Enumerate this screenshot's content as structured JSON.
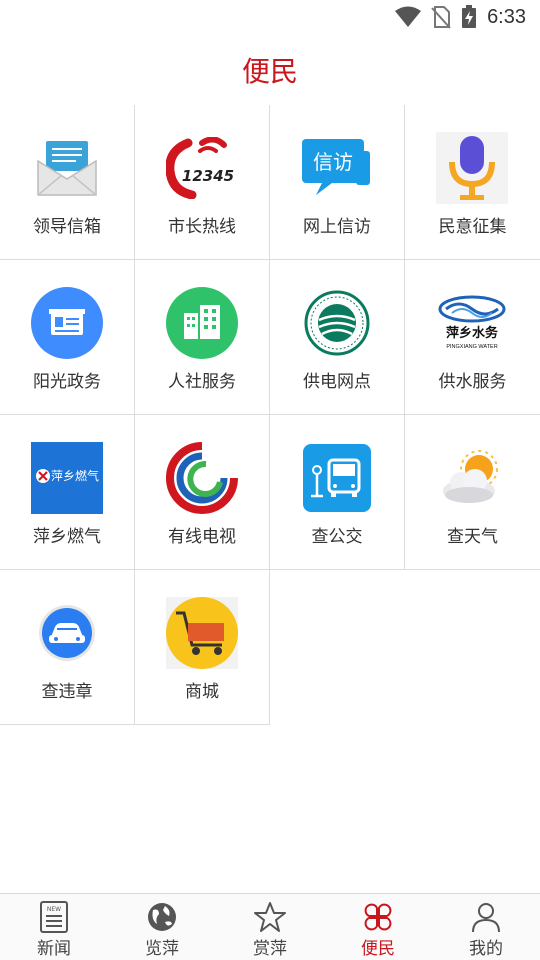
{
  "status_bar": {
    "time": "6:33"
  },
  "header": {
    "title": "便民"
  },
  "tiles": [
    {
      "label": "领导信箱",
      "icon": "envelope-icon"
    },
    {
      "label": "市长热线",
      "icon": "hotline-12345-icon",
      "icon_text": "12345"
    },
    {
      "label": "网上信访",
      "icon": "xinfang-chat-icon",
      "icon_text": "信访"
    },
    {
      "label": "民意征集",
      "icon": "microphone-icon"
    },
    {
      "label": "阳光政务",
      "icon": "id-card-icon"
    },
    {
      "label": "人社服务",
      "icon": "buildings-icon"
    },
    {
      "label": "供电网点",
      "icon": "state-grid-logo-icon"
    },
    {
      "label": "供水服务",
      "icon": "pingxiang-water-logo-icon",
      "icon_text": "萍乡水务",
      "icon_subtext": "PINGXIANG WATER"
    },
    {
      "label": "萍乡燃气",
      "icon": "pingxiang-gas-logo-icon",
      "icon_text": "萍乡燃气"
    },
    {
      "label": "有线电视",
      "icon": "cable-tv-logo-icon"
    },
    {
      "label": "查公交",
      "icon": "bus-icon"
    },
    {
      "label": "查天气",
      "icon": "weather-sun-cloud-icon"
    },
    {
      "label": "查违章",
      "icon": "car-icon"
    },
    {
      "label": "商城",
      "icon": "shopping-cart-icon"
    }
  ],
  "bottom_nav": [
    {
      "label": "新闻",
      "icon": "newspaper-icon",
      "icon_text": "NEW"
    },
    {
      "label": "览萍",
      "icon": "globe-icon"
    },
    {
      "label": "赏萍",
      "icon": "star-icon"
    },
    {
      "label": "便民",
      "icon": "clover-icon",
      "active": true
    },
    {
      "label": "我的",
      "icon": "person-icon"
    }
  ],
  "colors": {
    "accent": "#c8181e",
    "divider": "#dcdcdc",
    "text": "#333333"
  }
}
